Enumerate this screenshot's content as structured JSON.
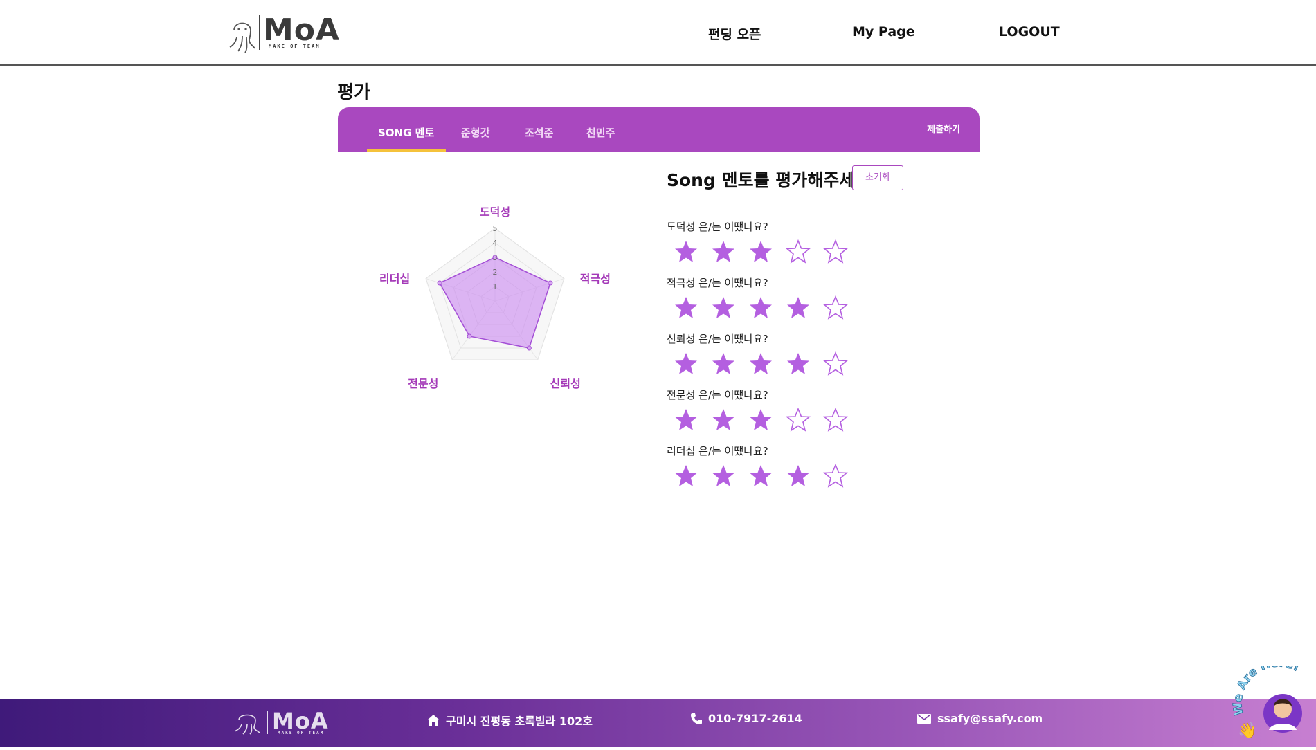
{
  "header": {
    "logo_text": "MoA",
    "logo_sub": "MAKE OF TEAM",
    "nav": [
      "펀딩 오픈",
      "My Page",
      "LOGOUT"
    ]
  },
  "page": {
    "title": "평가",
    "tabs": [
      "SONG 멘토",
      "준형갓",
      "조석준",
      "천민주"
    ],
    "active_tab": "SONG 멘토",
    "submit_label": "제출하기"
  },
  "radar": {
    "axes": [
      "도덕성",
      "적극성",
      "신뢰성",
      "전문성",
      "리더십"
    ],
    "scale_labels": [
      "1",
      "2",
      "3",
      "4",
      "5"
    ],
    "values": [
      3,
      4,
      4,
      3,
      4
    ],
    "max": 5
  },
  "evaluation": {
    "heading": "Song 멘토를 평가해주세요!",
    "reset_label": "초기화",
    "questions": [
      {
        "text": "도덕성 은/는 어땠나요?",
        "rating": 3
      },
      {
        "text": "적극성 은/는 어땠나요?",
        "rating": 4
      },
      {
        "text": "신뢰성 은/는 어땠나요?",
        "rating": 4
      },
      {
        "text": "전문성 은/는 어땠나요?",
        "rating": 3
      },
      {
        "text": "리더십 은/는 어땠나요?",
        "rating": 4
      }
    ],
    "max_rating": 5,
    "star_color": "#b45fe0"
  },
  "footer": {
    "logo_text": "MoA",
    "logo_sub": "MAKE OF TEAM",
    "address": "구미시 진평동 초록빌라 102호",
    "phone": "010-7917-2614",
    "email": "ssafy@ssafy.com"
  },
  "widget": {
    "text": "We Are Here!"
  },
  "colors": {
    "primary": "#a948bf",
    "tab_underline": "#f5c23b",
    "radar_fill": "#c77df0",
    "star": "#b45fe0"
  }
}
